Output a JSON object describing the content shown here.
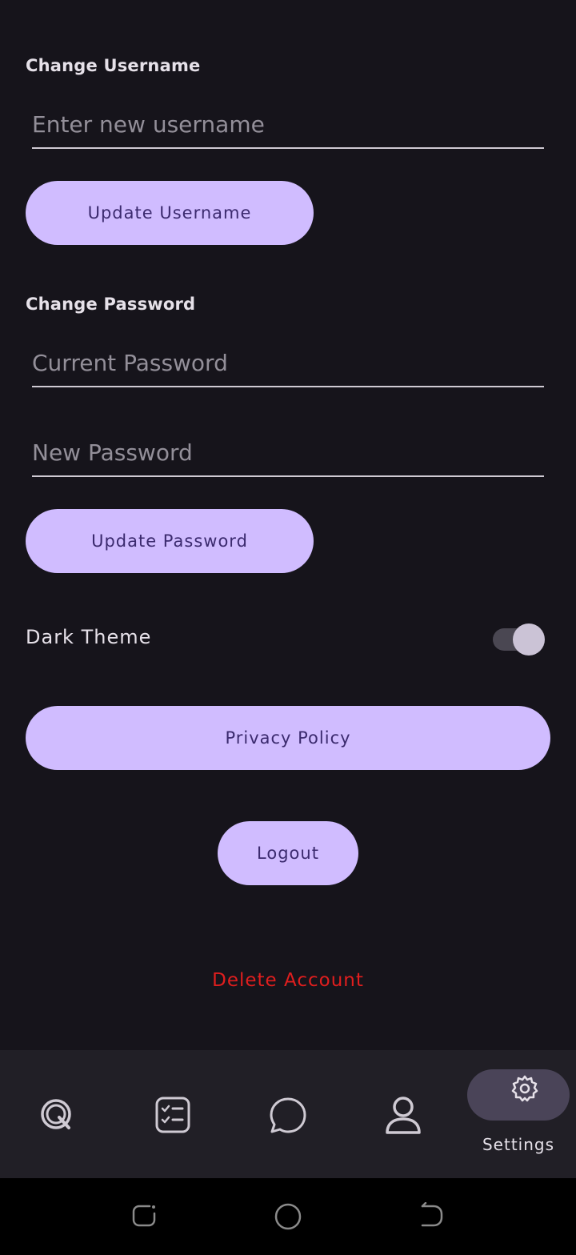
{
  "username_section": {
    "label": "Change Username",
    "input_placeholder": "Enter new username",
    "input_value": "",
    "button_label": "Update Username"
  },
  "password_section": {
    "label": "Change Password",
    "current_placeholder": "Current Password",
    "new_placeholder": "New Password",
    "button_label": "Update Password"
  },
  "theme": {
    "label": "Dark Theme",
    "enabled": true
  },
  "privacy_button_label": "Privacy Policy",
  "logout_button_label": "Logout",
  "delete_account_label": "Delete Account",
  "bottom_nav": {
    "items": [
      {
        "icon": "quiz-q-icon",
        "label": ""
      },
      {
        "icon": "checklist-icon",
        "label": ""
      },
      {
        "icon": "chat-bubble-icon",
        "label": ""
      },
      {
        "icon": "person-icon",
        "label": ""
      },
      {
        "icon": "gear-icon",
        "label": "Settings",
        "active": true
      }
    ]
  },
  "colors": {
    "background": "#16141b",
    "button_fill": "#d0bcff",
    "button_text": "#3b2a6e",
    "danger": "#e01e1e",
    "nav_background": "#211f26",
    "nav_active_pill": "#4a4458"
  }
}
